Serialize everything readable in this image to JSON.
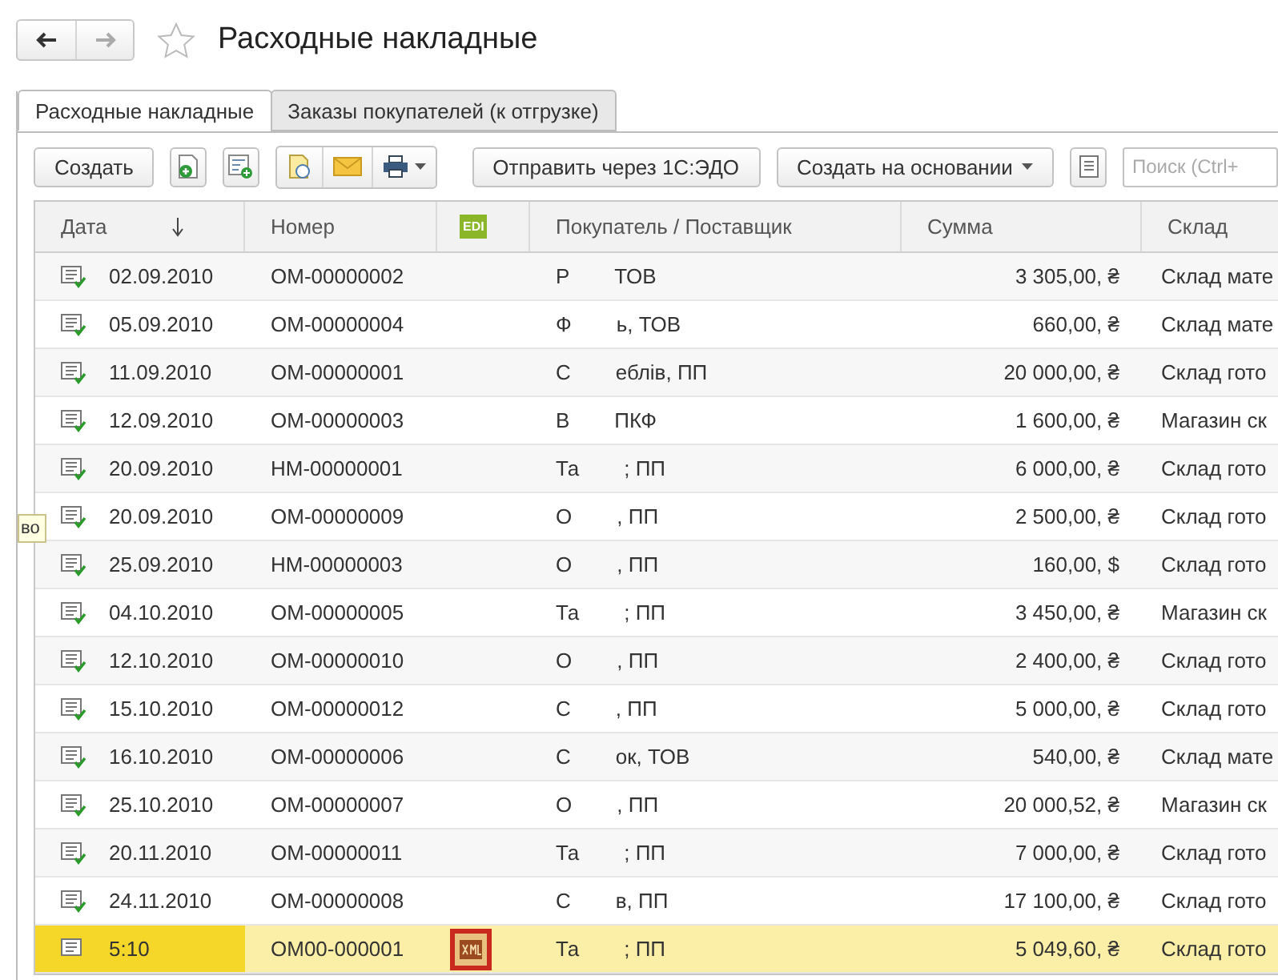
{
  "title": "Расходные накладные",
  "favorite": false,
  "tabs": [
    {
      "label": "Расходные накладные",
      "selected": true
    },
    {
      "label": "Заказы покупателей (к отгрузке)",
      "selected": false
    }
  ],
  "toolbar": {
    "create": "Создать",
    "send": "Отправить через 1С:ЭДО",
    "create_based": "Создать на основании",
    "search": {
      "placeholder": "Поиск (Ctrl+"
    }
  },
  "side_tooltip": "во",
  "table": {
    "columns": [
      "Дата",
      "Номер",
      "EDI",
      "Покупатель / Поставщик",
      "Сумма",
      "Склад"
    ],
    "rows": [
      {
        "posted": true,
        "date": "02.09.2010",
        "number": "ОМ-00000002",
        "has_xml": false,
        "buyer_lead": "Р",
        "buyer_tail": "ТОВ",
        "sum": "3 305,00, ₴",
        "warehouse": "Склад мате",
        "selected": false
      },
      {
        "posted": true,
        "date": "05.09.2010",
        "number": "ОМ-00000004",
        "has_xml": false,
        "buyer_lead": "Ф",
        "buyer_tail": "ь, ТОВ",
        "sum": "660,00, ₴",
        "warehouse": "Склад мате",
        "selected": false
      },
      {
        "posted": true,
        "date": "11.09.2010",
        "number": "ОМ-00000001",
        "has_xml": false,
        "buyer_lead": "С",
        "buyer_tail": "еблів, ПП",
        "sum": "20 000,00, ₴",
        "warehouse": "Склад гото",
        "selected": false
      },
      {
        "posted": true,
        "date": "12.09.2010",
        "number": "ОМ-00000003",
        "has_xml": false,
        "buyer_lead": "В",
        "buyer_tail": "ПКФ",
        "sum": "1 600,00, ₴",
        "warehouse": "Магазин ск",
        "selected": false
      },
      {
        "posted": true,
        "date": "20.09.2010",
        "number": "НМ-00000001",
        "has_xml": false,
        "buyer_lead": "Та",
        "buyer_tail": "; ПП",
        "sum": "6 000,00, ₴",
        "warehouse": "Склад гото",
        "selected": false
      },
      {
        "posted": true,
        "date": "20.09.2010",
        "number": "ОМ-00000009",
        "has_xml": false,
        "buyer_lead": "О",
        "buyer_tail": ", ПП",
        "sum": "2 500,00, ₴",
        "warehouse": "Склад гото",
        "selected": false
      },
      {
        "posted": true,
        "date": "25.09.2010",
        "number": "НМ-00000003",
        "has_xml": false,
        "buyer_lead": "О",
        "buyer_tail": ", ПП",
        "sum": "160,00, $",
        "warehouse": "Склад гото",
        "selected": false
      },
      {
        "posted": true,
        "date": "04.10.2010",
        "number": "ОМ-00000005",
        "has_xml": false,
        "buyer_lead": "Та",
        "buyer_tail": "; ПП",
        "sum": "3 450,00, ₴",
        "warehouse": "Магазин ск",
        "selected": false
      },
      {
        "posted": true,
        "date": "12.10.2010",
        "number": "ОМ-00000010",
        "has_xml": false,
        "buyer_lead": "О",
        "buyer_tail": ", ПП",
        "sum": "2 400,00, ₴",
        "warehouse": "Склад гото",
        "selected": false
      },
      {
        "posted": true,
        "date": "15.10.2010",
        "number": "ОМ-00000012",
        "has_xml": false,
        "buyer_lead": "С",
        "buyer_tail": ", ПП",
        "sum": "5 000,00, ₴",
        "warehouse": "Склад гото",
        "selected": false
      },
      {
        "posted": true,
        "date": "16.10.2010",
        "number": "ОМ-00000006",
        "has_xml": false,
        "buyer_lead": "С",
        "buyer_tail": "ок, ТОВ",
        "sum": "540,00, ₴",
        "warehouse": "Склад мате",
        "selected": false
      },
      {
        "posted": true,
        "date": "25.10.2010",
        "number": "ОМ-00000007",
        "has_xml": false,
        "buyer_lead": "О",
        "buyer_tail": ", ПП",
        "sum": "20 000,52, ₴",
        "warehouse": "Магазин ск",
        "selected": false
      },
      {
        "posted": true,
        "date": "20.11.2010",
        "number": "ОМ-00000011",
        "has_xml": false,
        "buyer_lead": "Та",
        "buyer_tail": "; ПП",
        "sum": "7 000,00, ₴",
        "warehouse": "Склад гото",
        "selected": false
      },
      {
        "posted": true,
        "date": "24.11.2010",
        "number": "ОМ-00000008",
        "has_xml": false,
        "buyer_lead": "С",
        "buyer_tail": "в, ПП",
        "sum": "17 100,00, ₴",
        "warehouse": "Склад гото",
        "selected": false
      },
      {
        "posted": false,
        "date": "5:10",
        "number": "ОМ00-000001",
        "has_xml": true,
        "buyer_lead": "Та",
        "buyer_tail": "; ПП",
        "sum": "5 049,60, ₴",
        "warehouse": "Склад гото",
        "selected": true
      }
    ]
  }
}
